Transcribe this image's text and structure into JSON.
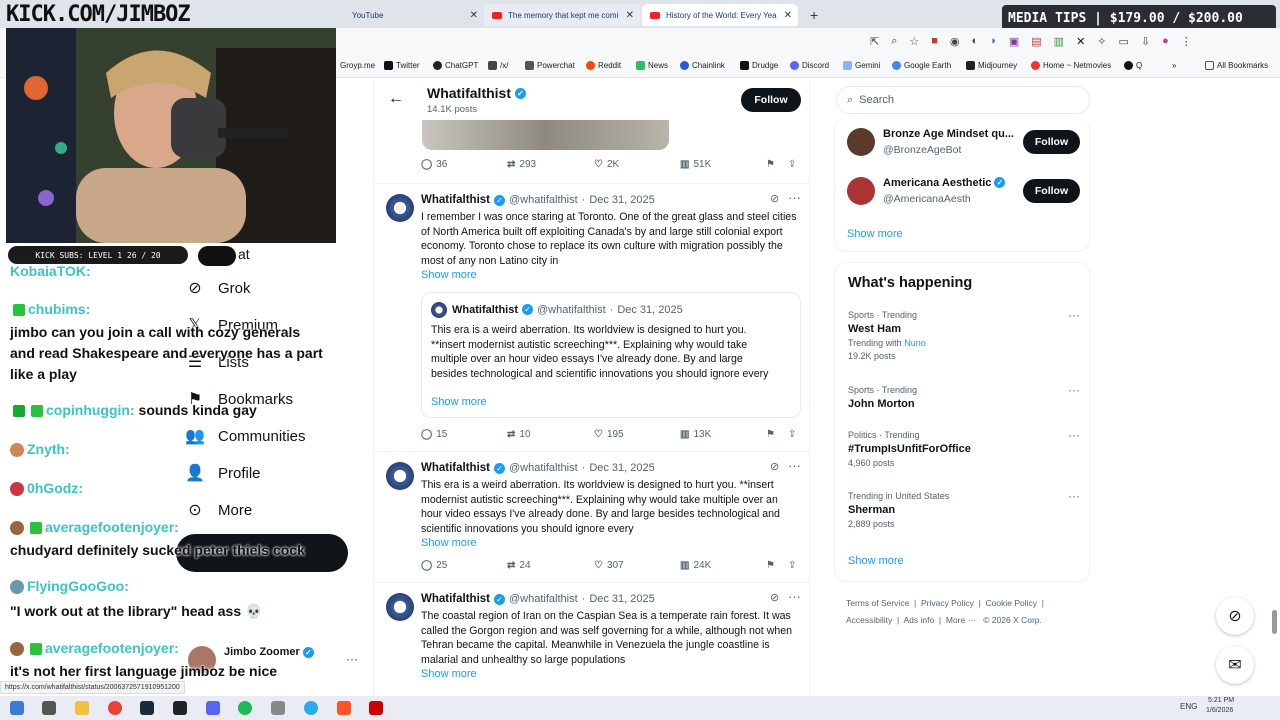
{
  "tabs": [
    {
      "label": "YouTube"
    },
    {
      "label": "The memory that kept me comi"
    },
    {
      "label": "History of the World: Every Yea"
    }
  ],
  "media_tips": "MEDIA TIPS | $179.00 / $200.00",
  "bookmarks": [
    "Groyp.me",
    "Twitter",
    "ChatGPT",
    "/x/",
    "Powerchat",
    "Reddit",
    "News",
    "Chainlink",
    "Drudge",
    "Discord",
    "Gemini",
    "Google Earth",
    "Midjourney",
    "Home ~ Netmovies",
    "Q",
    "All Bookmarks"
  ],
  "stream": {
    "watermark": "KICK.COM/JIMBOZ",
    "kick_subs": "KICK SUBS: LEVEL 1  26 / 20",
    "chat": [
      {
        "user": "KobaiaTOK:",
        "text": ""
      },
      {
        "user": "chubims:",
        "text": ""
      },
      {
        "user": "",
        "text": "jimbo can you join a call with cozy generals"
      },
      {
        "user": "",
        "text": "and read Shakespeare and everyone has a part"
      },
      {
        "user": "",
        "text": "like a play"
      },
      {
        "user": "copinhuggin:",
        "text": "sounds kinda gay"
      },
      {
        "user": "Znyth:",
        "text": ""
      },
      {
        "user": "0hGodz:",
        "text": ""
      },
      {
        "user": "averagefootenjoyer:",
        "text": ""
      },
      {
        "user": "",
        "text": "chudyard definitely sucked peter thiels cock"
      },
      {
        "user": "FlyingGooGoo:",
        "text": ""
      },
      {
        "user": "",
        "text": "\"I work out at the library\" head ass 💀"
      },
      {
        "user": "averagefootenjoyer:",
        "text": ""
      },
      {
        "user": "",
        "text": "it's not her first language jimboz be nice"
      }
    ]
  },
  "nav": {
    "items": [
      "Grok",
      "Premium",
      "Lists",
      "Bookmarks",
      "Communities",
      "Profile",
      "More"
    ],
    "partial": "at",
    "account_name": "Jimbo Zoomer"
  },
  "profile": {
    "name": "Whatifalthist",
    "posts": "14.1K posts",
    "follow": "Follow"
  },
  "tweets": [
    {
      "replies": "36",
      "reposts": "293",
      "likes": "2K",
      "views": "51K"
    },
    {
      "name": "Whatifalthist",
      "handle": "@whatifalthist",
      "date": "Dec 31, 2025",
      "text": "I remember I was once staring at Toronto. One of the great glass and steel cities of North America built off exploiting Canada's by and large still colonial export economy. Toronto chose to replace its own culture with migration possibly the most of any non Latino city in",
      "show_more": "Show more",
      "quote": {
        "name": "Whatifalthist",
        "handle": "@whatifalthist",
        "date": "Dec 31, 2025",
        "text": "This era is a weird aberration. Its worldview is designed to hurt you. **insert modernist autistic screeching***. Explaining why would take multiple over an hour video essays I've already done. By and large besides technological and scientific innovations you should ignore every",
        "show_more": "Show more"
      },
      "replies": "15",
      "reposts": "10",
      "likes": "195",
      "views": "13K"
    },
    {
      "name": "Whatifalthist",
      "handle": "@whatifalthist",
      "date": "Dec 31, 2025",
      "text": "This era is a weird aberration. Its worldview is designed to hurt you. **insert modernist autistic screeching***. Explaining why would take multiple over an hour video essays I've already done. By and large besides technological and scientific innovations you should ignore every",
      "show_more": "Show more",
      "replies": "25",
      "reposts": "24",
      "likes": "307",
      "views": "24K"
    },
    {
      "name": "Whatifalthist",
      "handle": "@whatifalthist",
      "date": "Dec 31, 2025",
      "text": "The coastal region of Iran on the Caspian Sea is a temperate rain forest. It was called the Gorgon region and was self governing for a while, although not when Tehran became the capital. Meanwhile in Venezuela the jungle coastline is malarial and unhealthy so large populations",
      "show_more": "Show more"
    }
  ],
  "right": {
    "search_placeholder": "Search",
    "suggestions": [
      {
        "name": "Bronze Age Mindset qu...",
        "handle": "@BronzeAgeBot",
        "follow": "Follow"
      },
      {
        "name": "Americana Aesthetic",
        "handle": "@AmericanaAesth",
        "follow": "Follow"
      }
    ],
    "show_more": "Show more",
    "whats_happening": "What's happening",
    "trends": [
      {
        "cat": "Sports · Trending",
        "title": "West Ham",
        "extra_prefix": "Trending with ",
        "extra_link": "Nuno",
        "count": "19.2K posts"
      },
      {
        "cat": "Sports · Trending",
        "title": "John Morton",
        "extra_prefix": "",
        "extra_link": "",
        "count": ""
      },
      {
        "cat": "Politics · Trending",
        "title": "#TrumpIsUnfitForOffice",
        "extra_prefix": "",
        "extra_link": "",
        "count": "4,960 posts"
      },
      {
        "cat": "Trending in United States",
        "title": "Sherman",
        "extra_prefix": "",
        "extra_link": "",
        "count": "2,889 posts"
      }
    ],
    "show_more2": "Show more",
    "footer": [
      "Terms of Service",
      "Privacy Policy",
      "Cookie Policy",
      "Accessibility",
      "Ads info",
      "More ···",
      "© 2026 X Corp."
    ]
  },
  "status_url": "https://x.com/whatifalthist/status/2006372571910951200",
  "taskbar": {
    "lang": "ENG",
    "time": "5:21 PM",
    "date": "1/6/2026"
  }
}
